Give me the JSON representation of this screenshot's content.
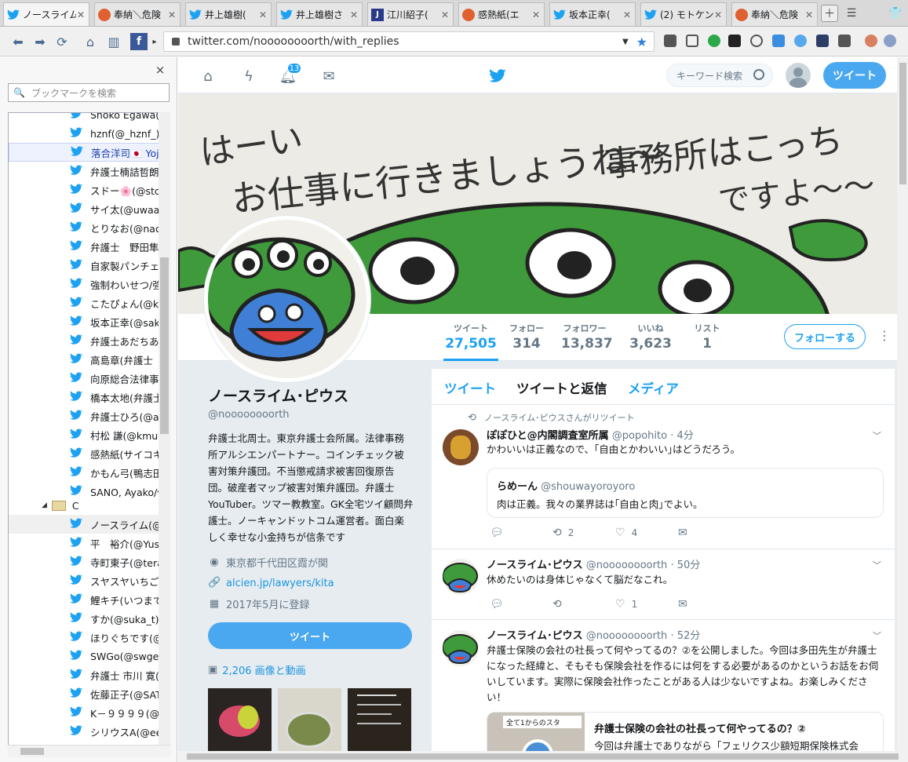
{
  "tabs": [
    {
      "title": "ノースライム",
      "favicon": "twitter-icon",
      "active": true
    },
    {
      "title": "奉納＼危険",
      "favicon": "daruma-icon"
    },
    {
      "title": "井上雄樹(",
      "favicon": "twitter-icon"
    },
    {
      "title": "井上雄樹さ",
      "favicon": "twitter-icon"
    },
    {
      "title": "江川紹子(",
      "favicon": "j-icon"
    },
    {
      "title": "感熱紙(エ",
      "favicon": "daruma-icon"
    },
    {
      "title": "坂本正幸(",
      "favicon": "twitter-icon"
    },
    {
      "title": "(2) モトケン",
      "favicon": "twitter-icon"
    },
    {
      "title": "奉納＼危険",
      "favicon": "daruma-icon"
    }
  ],
  "url": {
    "text": "twitter.com/noooooooorth/with_replies"
  },
  "sidebar": {
    "search_placeholder": "ブックマークを検索",
    "close": "×",
    "bookmarks": [
      "Shoko Egawa(@",
      "hznf(@_hznf_)",
      "落合洋司🇯🇵 Yoji",
      "弁護士楠詰哲朗",
      "スドー🌸(@stda",
      "サイ太(@uwaaa",
      "とりなお(@naot",
      "弁護士　野田隼",
      "自家製パンチェッ",
      "強制わいせつ/強",
      "こたぴょん(@ko",
      "坂本正幸(@sak",
      "弁護士あだちあ",
      "高島章(弁護士",
      "向原総合法律事",
      "橋本太地(弁護士",
      "弁護士ひろ(@ac",
      "村松 謙(@kmur",
      "感熱紙(サイコキ",
      "かもん弓(鴨志田",
      "SANO, Ayako/佐"
    ],
    "folder": "C",
    "bookmarks2": [
      "ノースライム(@n",
      "平　裕介(@Yus",
      "寺町東子(@tera",
      "スヤスヤいちご(",
      "鯉キチ(いつまで",
      "すか(@suka_t)",
      "ほりぐちです(@r",
      "SWGo(@swgen",
      "弁護士 市川 寛(",
      "佐藤正子(@SAT",
      "K－９９９９(@k9",
      "シリウスA(@eey"
    ]
  },
  "twitter": {
    "notif_count": "13",
    "search_placeholder": "キーワード検索",
    "tweet_button": "ツイート",
    "stats": [
      {
        "label": "ツイート",
        "value": "27,505"
      },
      {
        "label": "フォロー",
        "value": "314"
      },
      {
        "label": "フォロワー",
        "value": "13,837"
      },
      {
        "label": "いいね",
        "value": "3,623"
      },
      {
        "label": "リスト",
        "value": "1"
      }
    ],
    "follow_button": "フォローする",
    "profile": {
      "name": "ノースライム･ピウス",
      "handle": "@noooooooorth",
      "bio": "弁護士北周士。東京弁護士会所属。法律事務所アルシエンパートナー。コインチェック被害対策弁護団。不当懲戒請求被害回復原告団。破産者マップ被害対策弁護団。弁護士YouTuber。ツマー教教室。GK全宅ツイ顧問弁護士。ノーキャンドットコム運営者。面白楽しく幸せな小金持ちが信条です",
      "location": "東京都千代田区霞が関",
      "link": "alcien.jp/lawyers/kita",
      "joined": "2017年5月に登録",
      "tweet_button": "ツイート",
      "media": "2,206 画像と動画"
    },
    "timeline_tabs": [
      "ツイート",
      "ツイートと返信",
      "メディア"
    ],
    "tweets": [
      {
        "retweet_note": "ノースライム･ピウスさんがリツイート",
        "name": "ぽぽひと@内閣調査室所属",
        "handle": "@popohito",
        "time": "· 4分",
        "text": "かわいいは正義なので、｢自由とかわいい｣はどうだろう。",
        "quote_name": "らめーん",
        "quote_handle": "@shouwayoroyoro",
        "quote_text": "肉は正義。我々の業界誌は｢自由と肉｣でよい。",
        "retweets": "2",
        "likes": "4"
      },
      {
        "name": "ノースライム･ピウス",
        "handle": "@noooooooorth",
        "time": "· 50分",
        "text": "休めたいのは身体じゃなくて脳だなこれ。",
        "retweets": "",
        "likes": "1"
      },
      {
        "name": "ノースライム･ピウス",
        "handle": "@noooooooorth",
        "time": "· 52分",
        "text": "弁護士保険の会社の社長って何やってるの？②を公開しました。今回は多田先生が弁護士になった経緯と、そもそも保険会社を作るには何をする必要があるのかというお話をお伺いしています。実際に保険会社作ったことがある人は少ないですよね。お楽しみください！",
        "card_title": "弁護士保険の会社の社長って何やってるの？②",
        "card_desc": "今回は弁護士でありながら「フェリクス少額短期保険株式会",
        "card_thumb_text": "全て1からのスタ"
      }
    ]
  },
  "banner_text": {
    "line1": "はーい",
    "line2": "お仕事に行きましょうね～",
    "line3": "事務所はこっち",
    "line4": "ですよ～～"
  }
}
